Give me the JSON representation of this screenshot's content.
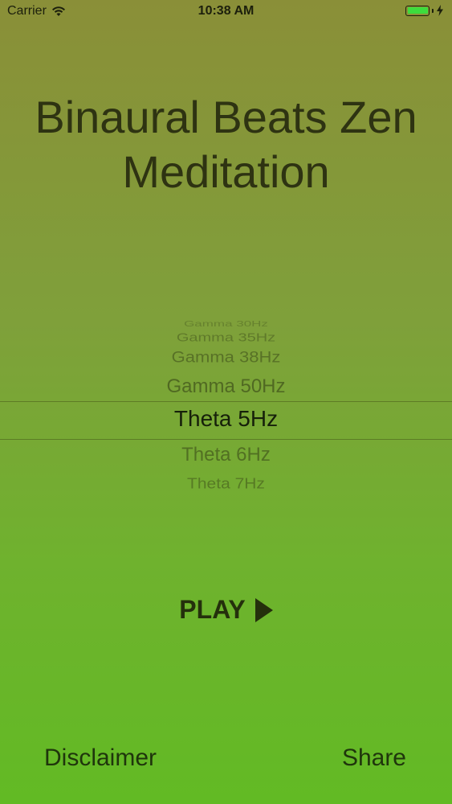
{
  "status_bar": {
    "carrier": "Carrier",
    "time": "10:38 AM",
    "icons": [
      "wifi-icon",
      "battery-icon",
      "charging-bolt-icon"
    ],
    "battery_level": 1.0,
    "battery_color": "#3ddc3d"
  },
  "title": {
    "line1": "Binaural Beats Zen",
    "line2": "Meditation"
  },
  "picker": {
    "options": [
      "Gamma 30Hz",
      "Gamma 35Hz",
      "Gamma 38Hz",
      "Gamma 50Hz",
      "Theta 5Hz",
      "Theta 6Hz",
      "Theta 7Hz"
    ],
    "selected": "Theta 5Hz"
  },
  "play": {
    "label": "PLAY",
    "icon": "play-icon"
  },
  "footer": {
    "disclaimer_label": "Disclaimer",
    "share_label": "Share"
  },
  "colors": {
    "background_top": "#8a8f38",
    "background_bottom": "#62ba24",
    "text": "#2e3312"
  }
}
